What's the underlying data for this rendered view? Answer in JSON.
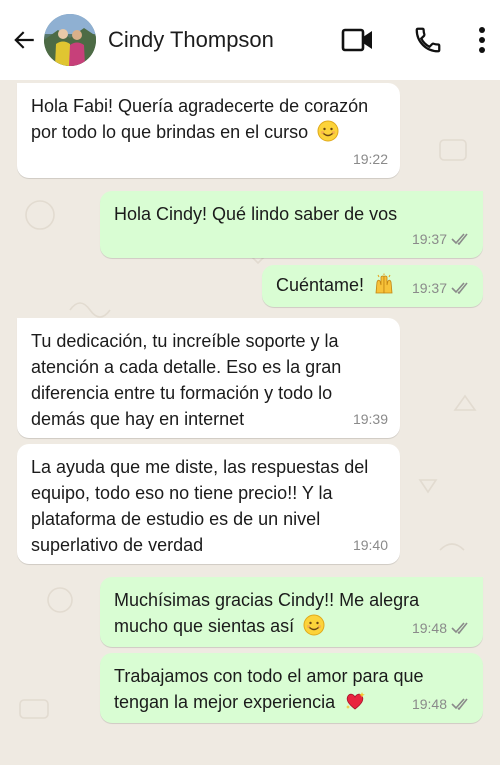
{
  "contact": {
    "name": "Cindy Thompson"
  },
  "icons": {
    "back": "arrow-left-icon",
    "video": "video-camera-icon",
    "call": "phone-icon",
    "menu": "more-vertical-icon",
    "read": "double-check-icon"
  },
  "colors": {
    "incoming": "#ffffff",
    "outgoing": "#d9fdd3",
    "background": "#efeae2",
    "ticks": "#8a8a8a"
  },
  "messages": [
    {
      "dir": "in",
      "text": "Hola Fabi! Quería agradecerte de corazón por todo lo que brindas en el curso",
      "emoji": "smiling-face-emoji",
      "time": "19:22"
    },
    {
      "dir": "out",
      "text": "Hola Cindy! Qué lindo saber de vos",
      "time": "19:37",
      "status": "read"
    },
    {
      "dir": "out",
      "text": "Cuéntame!",
      "emoji": "raising-hands-emoji",
      "time": "19:37",
      "status": "read"
    },
    {
      "dir": "in",
      "text": "Tu dedicación, tu increíble soporte y la atención a cada detalle. Eso es la gran diferencia entre tu formación y todo lo demás que hay en internet",
      "time": "19:39"
    },
    {
      "dir": "in",
      "text": "La ayuda que me diste, las respuestas del equipo, todo eso no tiene precio!! Y la plataforma de estudio es de un nivel superlativo de verdad",
      "time": "19:40"
    },
    {
      "dir": "out",
      "text": "Muchísimas gracias Cindy!! Me alegra mucho que sientas así",
      "emoji": "smiling-face-emoji",
      "time": "19:48",
      "status": "read"
    },
    {
      "dir": "out",
      "text": "Trabajamos con todo el amor para que tengan la mejor experiencia",
      "emoji": "sparkling-heart-emoji",
      "time": "19:48",
      "status": "read"
    }
  ]
}
